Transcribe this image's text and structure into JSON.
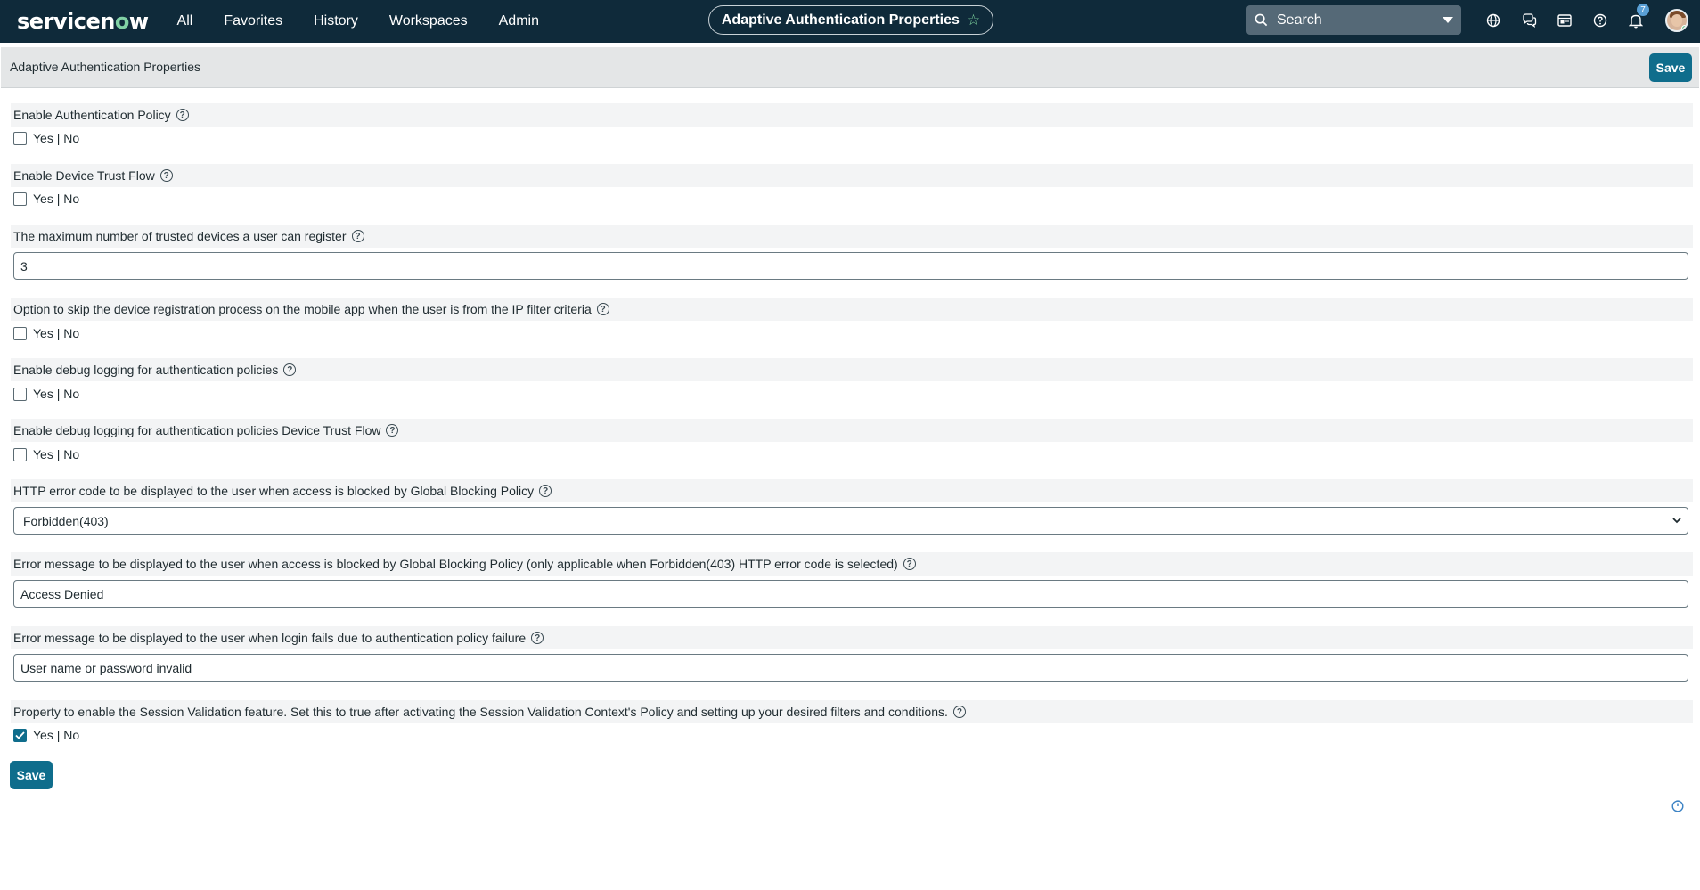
{
  "topbar": {
    "logo_text_a": "servicen",
    "logo_text_o": "o",
    "logo_text_b": "w",
    "nav": [
      "All",
      "Favorites",
      "History",
      "Workspaces",
      "Admin"
    ],
    "context_title": "Adaptive Authentication Properties",
    "search_placeholder": "Search",
    "notification_count": "7",
    "icons": [
      "globe-icon",
      "chat-icon",
      "inbox-icon",
      "help-icon",
      "bell-icon"
    ]
  },
  "header": {
    "title": "Adaptive Authentication Properties",
    "save_label": "Save"
  },
  "properties": [
    {
      "label": "Enable Authentication Policy",
      "type": "checkbox",
      "option": "Yes | No",
      "checked": false
    },
    {
      "label": "Enable Device Trust Flow",
      "type": "checkbox",
      "option": "Yes | No",
      "checked": false
    },
    {
      "label": "The maximum number of trusted devices a user can register",
      "type": "text",
      "value": "3"
    },
    {
      "label": "Option to skip the device registration process on the mobile app when the user is from the IP filter criteria",
      "type": "checkbox",
      "option": "Yes | No",
      "checked": false
    },
    {
      "label": "Enable debug logging for authentication policies",
      "type": "checkbox",
      "option": "Yes | No",
      "checked": false
    },
    {
      "label": "Enable debug logging for authentication policies Device Trust Flow",
      "type": "checkbox",
      "option": "Yes | No",
      "checked": false
    },
    {
      "label": "HTTP error code to be displayed to the user when access is blocked by Global Blocking Policy",
      "type": "select",
      "value": "Forbidden(403)"
    },
    {
      "label": "Error message to be displayed to the user when access is blocked by Global Blocking Policy (only applicable when Forbidden(403) HTTP error code is selected)",
      "type": "text",
      "value": "Access Denied"
    },
    {
      "label": "Error message to be displayed to the user when login fails due to authentication policy failure",
      "type": "text",
      "value": "User name or password invalid"
    },
    {
      "label": "Property to enable the Session Validation feature. Set this to true after activating the Session Validation Context's Policy and setting up your desired filters and conditions.",
      "type": "checkbox",
      "option": "Yes | No",
      "checked": true
    }
  ],
  "footer": {
    "save_label": "Save"
  },
  "colors": {
    "topbar_bg": "#0f2a3a",
    "accent": "#0f6d8c",
    "logo_accent": "#81d2a5"
  }
}
